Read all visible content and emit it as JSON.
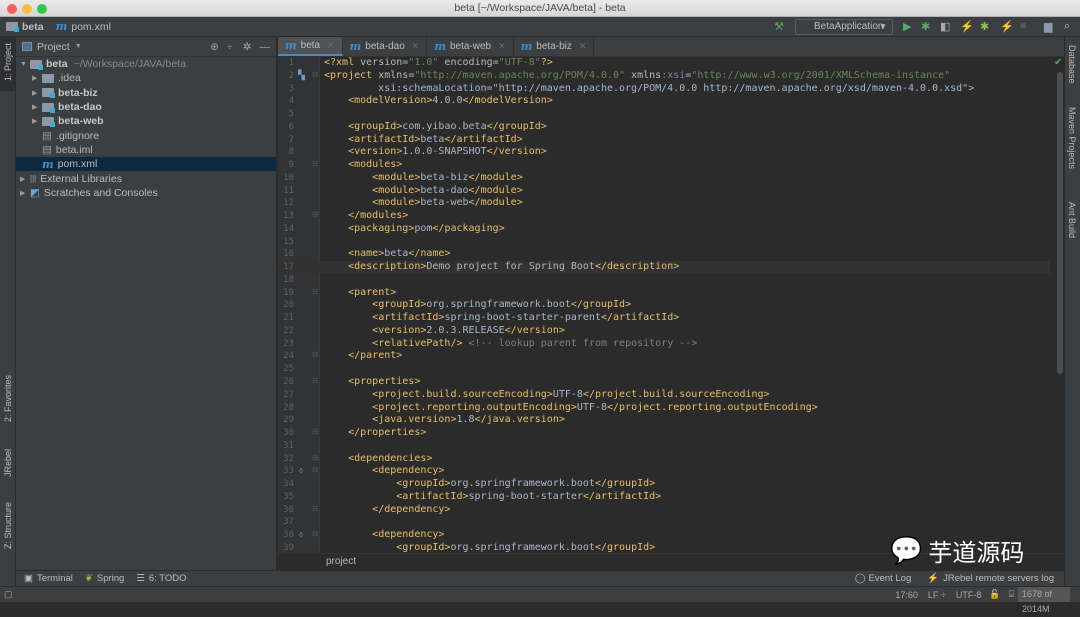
{
  "window": {
    "title": "beta [~/Workspace/JAVA/beta] - beta"
  },
  "navbar": {
    "project": "beta",
    "file": "pom.xml",
    "run_config": "BetaApplication"
  },
  "left_strip": {
    "project": "1: Project",
    "favorites": "2: Favorites",
    "jrebel": "JRebel",
    "structure": "Z: Structure"
  },
  "right_strip": {
    "database": "Database",
    "maven": "Maven Projects",
    "ant": "Ant Build"
  },
  "project_panel": {
    "title": "Project",
    "tree": [
      {
        "label": "beta",
        "hint": "~/Workspace/JAVA/beta",
        "depth": 0,
        "arrow": "▼",
        "icon": "module-folder",
        "bold": true
      },
      {
        "label": ".idea",
        "depth": 1,
        "arrow": "▶",
        "icon": "folder"
      },
      {
        "label": "beta-biz",
        "depth": 1,
        "arrow": "▶",
        "icon": "module-folder",
        "bold": true
      },
      {
        "label": "beta-dao",
        "depth": 1,
        "arrow": "▶",
        "icon": "module-folder",
        "bold": true
      },
      {
        "label": "beta-web",
        "depth": 1,
        "arrow": "▶",
        "icon": "module-folder",
        "bold": true
      },
      {
        "label": ".gitignore",
        "depth": 1,
        "arrow": "",
        "icon": "file"
      },
      {
        "label": "beta.iml",
        "depth": 1,
        "arrow": "",
        "icon": "file"
      },
      {
        "label": "pom.xml",
        "depth": 1,
        "arrow": "",
        "icon": "maven",
        "selected": true
      },
      {
        "label": "External Libraries",
        "depth": 0,
        "arrow": "▶",
        "icon": "library"
      },
      {
        "label": "Scratches and Consoles",
        "depth": 0,
        "arrow": "▶",
        "icon": "scratch"
      }
    ]
  },
  "tabs": [
    {
      "label": "beta",
      "active": true
    },
    {
      "label": "beta-dao"
    },
    {
      "label": "beta-web"
    },
    {
      "label": "beta-biz"
    }
  ],
  "editor": {
    "current_line": 17,
    "lines": [
      "<?xml version=\"1.0\" encoding=\"UTF-8\"?>",
      "<project xmlns=\"http://maven.apache.org/POM/4.0.0\" xmlns:xsi=\"http://www.w3.org/2001/XMLSchema-instance\"",
      "         xsi:schemaLocation=\"http://maven.apache.org/POM/4.0.0 http://maven.apache.org/xsd/maven-4.0.0.xsd\">",
      "    <modelVersion>4.0.0</modelVersion>",
      "",
      "    <groupId>com.yibao.beta</groupId>",
      "    <artifactId>beta</artifactId>",
      "    <version>1.0.0-SNAPSHOT</version>",
      "    <modules>",
      "        <module>beta-biz</module>",
      "        <module>beta-dao</module>",
      "        <module>beta-web</module>",
      "    </modules>",
      "    <packaging>pom</packaging>",
      "",
      "    <name>beta</name>",
      "    <description>Demo project for Spring Boot</description>",
      "",
      "    <parent>",
      "        <groupId>org.springframework.boot</groupId>",
      "        <artifactId>spring-boot-starter-parent</artifactId>",
      "        <version>2.0.3.RELEASE</version>",
      "        <relativePath/> <!-- lookup parent from repository -->",
      "    </parent>",
      "",
      "    <properties>",
      "        <project.build.sourceEncoding>UTF-8</project.build.sourceEncoding>",
      "        <project.reporting.outputEncoding>UTF-8</project.reporting.outputEncoding>",
      "        <java.version>1.8</java.version>",
      "    </properties>",
      "",
      "    <dependencies>",
      "        <dependency>",
      "            <groupId>org.springframework.boot</groupId>",
      "            <artifactId>spring-boot-starter</artifactId>",
      "        </dependency>",
      "",
      "        <dependency>",
      "            <groupId>org.springframework.boot</groupId>"
    ]
  },
  "breadcrumb": "project",
  "bottom_tools": {
    "terminal": "Terminal",
    "spring": "Spring",
    "todo": "6: TODO",
    "event_log": "Event Log",
    "jrebel_log": "JRebel remote servers log"
  },
  "status": {
    "position": "17:60",
    "line_sep": "LF ÷",
    "encoding": "UTF-8",
    "memory": "1678 of 2014M",
    "memory_fraction": 0.833
  },
  "watermark": "芋道源码",
  "colors": {
    "tag": "#e8bf6a",
    "value": "#6a8759",
    "text": "#a9b7c6",
    "selection": "#0d293e",
    "accent": "#4a88c7"
  }
}
